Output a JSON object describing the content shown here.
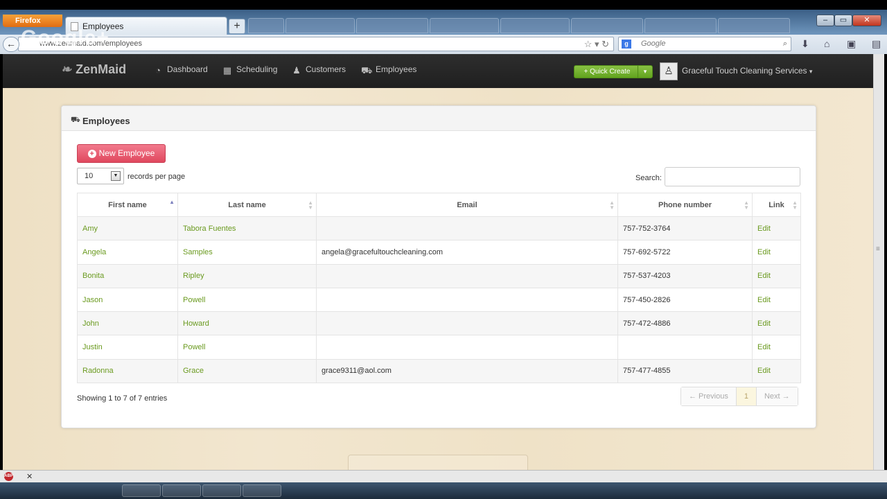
{
  "browser": {
    "firefox_label": "Firefox",
    "tab_title": "Employees",
    "new_tab_symbol": "+",
    "url": "www.zenmaid.com/employees",
    "search_placeholder": "Google",
    "gplus_overlay": "Google+",
    "window_buttons": [
      "–",
      "▭",
      "✕"
    ]
  },
  "app": {
    "brand": "ZenMaid",
    "nav": [
      {
        "label": "Dashboard",
        "icon": "dashboard-icon"
      },
      {
        "label": "Scheduling",
        "icon": "calendar-icon"
      },
      {
        "label": "Customers",
        "icon": "users-icon"
      },
      {
        "label": "Employees",
        "icon": "truck-icon"
      }
    ],
    "quick_create": "+ Quick Create",
    "account_name": "Graceful Touch Cleaning Services"
  },
  "panel": {
    "title": "Employees",
    "new_button": "New Employee",
    "records_value": "10",
    "records_label": "records per page",
    "search_label": "Search:",
    "columns": [
      "First name",
      "Last name",
      "Email",
      "Phone number",
      "Link"
    ],
    "rows": [
      {
        "first": "Amy",
        "last": "Tabora Fuentes",
        "email": "",
        "phone": "757-752-3764",
        "link": "Edit"
      },
      {
        "first": "Angela",
        "last": "Samples",
        "email": "angela@gracefultouchcleaning.com",
        "phone": "757-692-5722",
        "link": "Edit"
      },
      {
        "first": "Bonita",
        "last": "Ripley",
        "email": "",
        "phone": "757-537-4203",
        "link": "Edit"
      },
      {
        "first": "Jason",
        "last": "Powell",
        "email": "",
        "phone": "757-450-2826",
        "link": "Edit"
      },
      {
        "first": "John",
        "last": "Howard",
        "email": "",
        "phone": "757-472-4886",
        "link": "Edit"
      },
      {
        "first": "Justin",
        "last": "Powell",
        "email": "",
        "phone": "",
        "link": "Edit"
      },
      {
        "first": "Radonna",
        "last": "Grace",
        "email": "grace9311@aol.com",
        "phone": "757-477-4855",
        "link": "Edit"
      }
    ],
    "showing": "Showing 1 to 7 of 7 entries",
    "pager": {
      "previous": "← Previous",
      "current": "1",
      "next": "Next →"
    }
  },
  "colors": {
    "brand_green": "#62a41f",
    "link_green": "#6a9a1f",
    "new_button_red": "#e0485e"
  }
}
